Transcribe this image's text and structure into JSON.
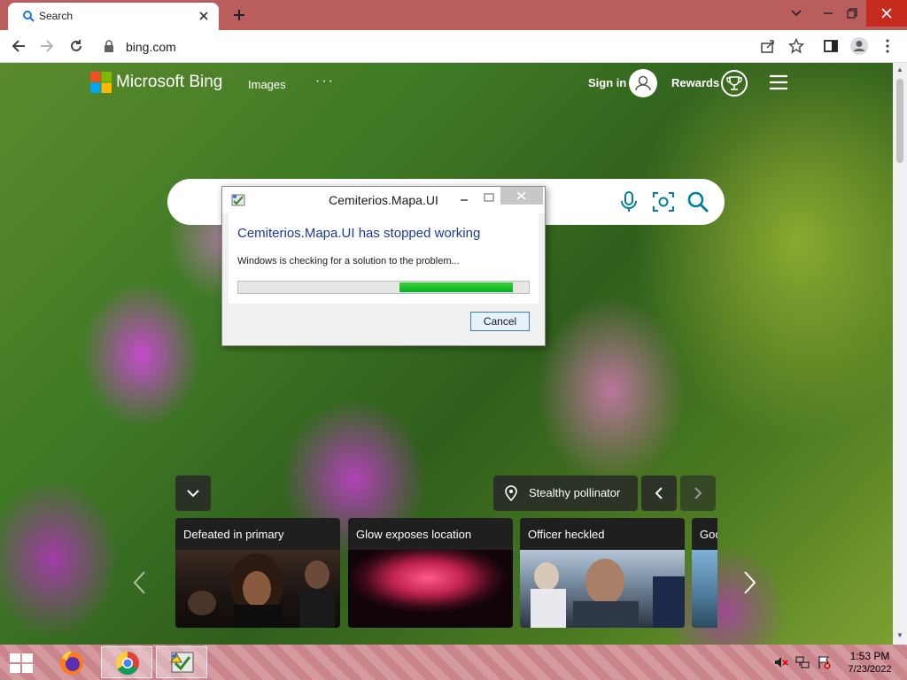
{
  "browser": {
    "tab": {
      "title": "Search",
      "favicon": "bing-search-icon"
    },
    "new_tab_icon": "plus-icon",
    "url": "bing.com",
    "toolbar_icons": [
      "back-icon",
      "forward-icon",
      "reload-icon",
      "share-icon",
      "star-icon",
      "sidepanel-icon",
      "profile-icon",
      "kebab-menu-icon"
    ]
  },
  "bing": {
    "brand": "Microsoft Bing",
    "nav": {
      "images": "Images",
      "more": "···"
    },
    "sign_in": "Sign in",
    "rewards": "Rewards",
    "image_caption": "Stealthy pollinator",
    "news_cards": [
      {
        "title": "Defeated in primary"
      },
      {
        "title": "Glow exposes location"
      },
      {
        "title": "Officer heckled"
      },
      {
        "title": "Goo"
      }
    ]
  },
  "dialog": {
    "title": "Cemiterios.Mapa.UI",
    "heading": "Cemiterios.Mapa.UI has stopped working",
    "message": "Windows is checking for a solution to the problem...",
    "cancel_label": "Cancel",
    "progress_fraction": 0.39
  },
  "taskbar": {
    "apps": [
      "firefox-icon",
      "chrome-icon",
      "app-error-icon"
    ],
    "active_app": "chrome-icon",
    "tray": [
      "speaker-muted-icon",
      "network-icon",
      "action-center-flag-icon"
    ],
    "time": "1:53 PM",
    "date": "7/23/2022"
  },
  "colors": {
    "tabbar": "#ba5d5d",
    "dialog_heading": "#1c3a95",
    "progress_green": "#06b025",
    "bing_search_blue": "#00809d"
  }
}
